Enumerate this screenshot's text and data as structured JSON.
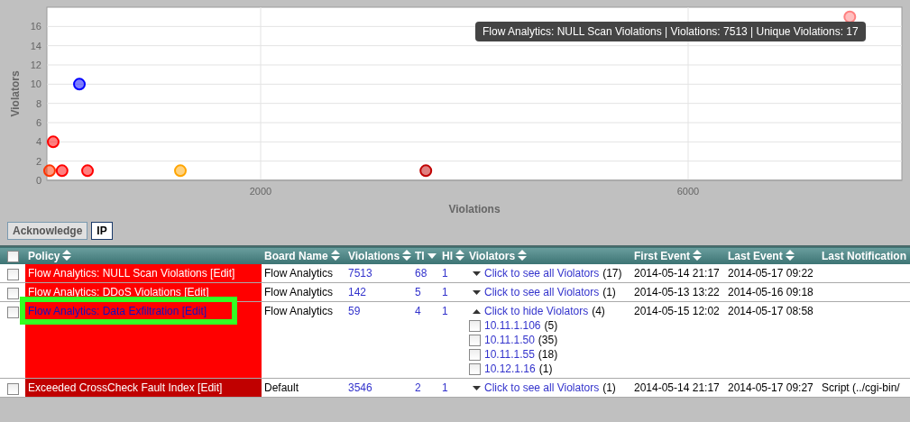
{
  "chart": {
    "tooltip": "Flow Analytics: NULL Scan Violations | Violations: 7513 | Unique Violations: 17",
    "chart_data": {
      "type": "scatter",
      "grid": true,
      "xlabel": "Violations",
      "ylabel": "Violators",
      "xlim": [
        0,
        8000
      ],
      "ylim": [
        0,
        18
      ],
      "xticks": [
        2000,
        6000
      ],
      "yticks": [
        0,
        2,
        4,
        6,
        8,
        10,
        12,
        14,
        16
      ],
      "series": [
        {
          "color": "#ff3300",
          "x": [
            25
          ],
          "values": [
            1
          ]
        },
        {
          "color": "#ff0000",
          "x": [
            59
          ],
          "values": [
            4
          ]
        },
        {
          "color": "#ff0000",
          "x": [
            142
          ],
          "values": [
            1
          ]
        },
        {
          "color": "#0000ff",
          "x": [
            304
          ],
          "values": [
            10
          ]
        },
        {
          "color": "#ff0000",
          "x": [
            380
          ],
          "values": [
            1
          ]
        },
        {
          "color": "#ffa500",
          "x": [
            1249
          ],
          "values": [
            1
          ]
        },
        {
          "color": "#c00000",
          "x": [
            3546
          ],
          "values": [
            1
          ]
        },
        {
          "color": "#ff8080",
          "x": [
            7513
          ],
          "values": [
            17
          ]
        }
      ]
    }
  },
  "buttons": [
    {
      "label": "Acknowledge",
      "selected": false
    },
    {
      "label": "IP",
      "selected": true
    }
  ],
  "table": {
    "header_checked": false,
    "columns": [
      {
        "label": "Policy",
        "sorted": false
      },
      {
        "label": "Board Name",
        "sorted": false
      },
      {
        "label": "Violations",
        "sorted": false
      },
      {
        "label": "TI",
        "sorted": true
      },
      {
        "label": "HI",
        "sorted": false
      },
      {
        "label": "Violators",
        "sorted": false
      },
      {
        "label": "First Event",
        "sorted": false
      },
      {
        "label": "Last Event",
        "sorted": false
      },
      {
        "label": "Last Notification"
      }
    ],
    "rows": [
      {
        "checked": false,
        "highlighted": false,
        "color": "#ff0000",
        "policy": "Flow Analytics: NULL Scan Violations [Edit]",
        "board": "Flow Analytics",
        "violations": "7513",
        "ti": "68",
        "hi": "1",
        "violators_link": "Click to see all Violators",
        "violators_count": "(17)",
        "expanded": false,
        "first_event": "2014-05-14 21:17",
        "last_event": "2014-05-17 09:22"
      },
      {
        "checked": false,
        "highlighted": false,
        "color": "#ff0000",
        "policy": "Flow Analytics: DDoS Violations [Edit]",
        "board": "Flow Analytics",
        "violations": "142",
        "ti": "5",
        "hi": "1",
        "violators_link": "Click to see all Violators",
        "violators_count": "(1)",
        "expanded": false,
        "first_event": "2014-05-13 13:22",
        "last_event": "2014-05-16 09:18"
      },
      {
        "checked": false,
        "highlighted": true,
        "color": "#ff0000",
        "policy": "Flow Analytics: Data Exfiltration [Edit]",
        "board": "Flow Analytics",
        "violations": "59",
        "ti": "4",
        "hi": "1",
        "violators_link": "Click to hide Violators",
        "violators_count": "(4)",
        "expanded": true,
        "first_event": "2014-05-15 12:02",
        "last_event": "2014-05-17 08:58",
        "violator_list": [
          {
            "ip": "10.11.1.106",
            "count": "(5)",
            "checked": false
          },
          {
            "ip": "10.11.1.50",
            "count": "(35)",
            "checked": false
          },
          {
            "ip": "10.11.1.55",
            "count": "(18)",
            "checked": false
          },
          {
            "ip": "10.12.1.16",
            "count": "(1)",
            "checked": false
          }
        ]
      },
      {
        "checked": false,
        "highlighted": false,
        "color": "#c00000",
        "policy": "Exceeded CrossCheck Fault Index [Edit]",
        "board": "Default",
        "violations": "3546",
        "ti": "2",
        "hi": "1",
        "violators_link": "Click to see all Violators",
        "violators_count": "(1)",
        "expanded": false,
        "first_event": "2014-05-14 21:17",
        "last_event": "2014-05-17 09:27",
        "last_notification": "Script (../cgi-bin/"
      }
    ]
  }
}
